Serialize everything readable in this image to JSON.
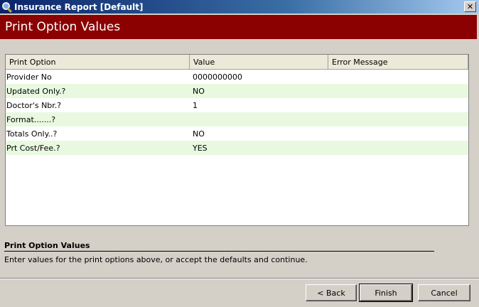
{
  "window": {
    "title": "Insurance Report [Default]",
    "close_glyph": "✕",
    "icon": "magnifier-icon"
  },
  "header": {
    "title": "Print Option Values"
  },
  "grid": {
    "columns": [
      "Print Option",
      "Value",
      "Error Message"
    ],
    "rows": [
      {
        "option": "Provider No",
        "value": "0000000000",
        "error": ""
      },
      {
        "option": "Updated Only.?",
        "value": "NO",
        "error": ""
      },
      {
        "option": "Doctor's Nbr.?",
        "value": "1",
        "error": ""
      },
      {
        "option": "Format.......?",
        "value": "",
        "error": ""
      },
      {
        "option": "Totals Only..?",
        "value": "NO",
        "error": ""
      },
      {
        "option": "Prt Cost/Fee.?",
        "value": "YES",
        "error": ""
      }
    ]
  },
  "help": {
    "title": "Print Option Values",
    "text": "Enter values for the print options above, or accept the defaults and continue."
  },
  "buttons": {
    "back": "< Back",
    "finish": "Finish",
    "cancel": "Cancel"
  },
  "colors": {
    "header_bg": "#8b0000",
    "alt_row": "#e8f9e0"
  }
}
